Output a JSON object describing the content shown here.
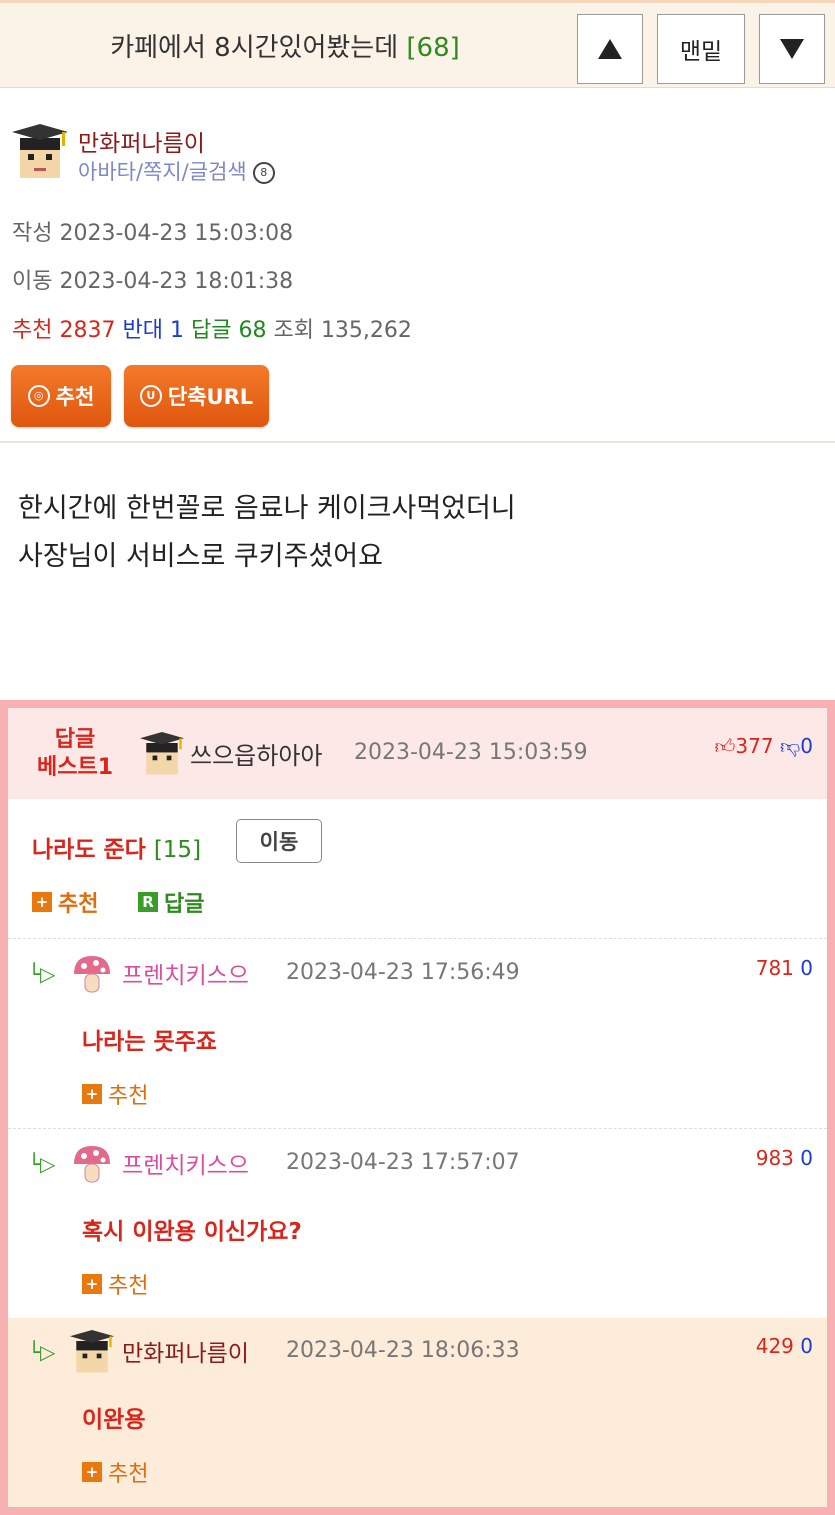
{
  "header": {
    "title": "카페에서 8시간있어봤는데",
    "comment_count": "[68]",
    "bottom_label": "맨밑"
  },
  "post": {
    "author": "만화퍼나름이",
    "author_links": "아바타/쪽지/글검색",
    "written_label": "작성",
    "written_at": "2023-04-23 15:03:08",
    "moved_label": "이동",
    "moved_at": "2023-04-23 18:01:38",
    "stats": {
      "recommend_label": "추천",
      "recommend": "2837",
      "oppose_label": "반대",
      "oppose": "1",
      "reply_label": "답글",
      "reply": "68",
      "views_label": "조회",
      "views": "135,262"
    },
    "recommend_button": "추천",
    "shorturl_button": "단축URL",
    "body_lines": [
      "한시간에 한번꼴로 음료나 케이크사먹었더니",
      "사장님이 서비스로 쿠키주셨어요"
    ]
  },
  "best_reply": {
    "label_line1": "답글",
    "label_line2": "베스트1",
    "author": "쓰으읍하아아",
    "date": "2023-04-23 15:03:59",
    "up": "377",
    "down": "0",
    "title": "나라도 준다",
    "count": "[15]",
    "move_button": "이동",
    "recommend": "추천",
    "reply": "답글"
  },
  "sub_replies": [
    {
      "author": "프렌치키스으",
      "date": "2023-04-23 17:56:49",
      "up": "781",
      "down": "0",
      "message": "나라는 못주죠",
      "recommend": "추천"
    },
    {
      "author": "프렌치키스으",
      "date": "2023-04-23 17:57:07",
      "up": "983",
      "down": "0",
      "message": "혹시 이완용 이신가요?",
      "recommend": "추천"
    },
    {
      "author": "만화퍼나름이",
      "date": "2023-04-23 18:06:33",
      "up": "429",
      "down": "0",
      "message": "이완용",
      "recommend": "추천"
    }
  ],
  "colors": {
    "accent_orange": "#e8790e",
    "best_border": "#f7b1b3",
    "highlight_row": "#fdecd9"
  }
}
